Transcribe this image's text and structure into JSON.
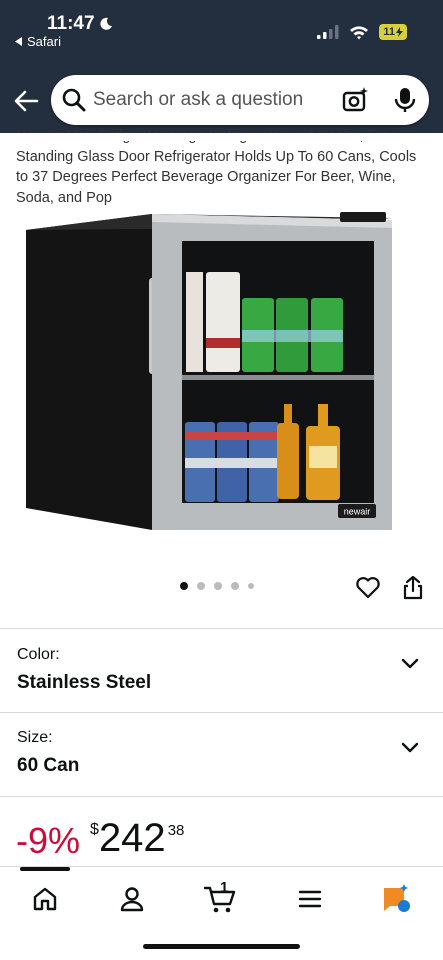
{
  "status_bar": {
    "time": "11:47",
    "back_app": "Safari",
    "battery": "11"
  },
  "search": {
    "placeholder": "Search or ask a question"
  },
  "product": {
    "title": "NewAir Mini Fridge Beverage Refrigerator and Cooler, Free Standing Glass Door Refrigerator Holds Up To 60 Cans, Cools to 37 Degrees Perfect Beverage Organizer For Beer, Wine, Soda, and Pop",
    "brand_badge": "newair",
    "image_count": 5,
    "active_image_index": 0
  },
  "selectors": {
    "color": {
      "label": "Color:",
      "value": "Stainless Steel"
    },
    "size": {
      "label": "Size:",
      "value": "60 Can"
    }
  },
  "price": {
    "discount": "-9%",
    "currency": "$",
    "whole": "242",
    "fraction": "38"
  },
  "tabbar": {
    "items": [
      "home-icon",
      "account-icon",
      "cart-icon",
      "menu-icon",
      "rufus-icon"
    ],
    "cart_count": "1",
    "active_index": 0
  },
  "colors": {
    "header_bg": "#232f3e",
    "discount": "#cc0c39",
    "rufus_orange": "#f08a24",
    "rufus_blue": "#1b7bd3"
  }
}
